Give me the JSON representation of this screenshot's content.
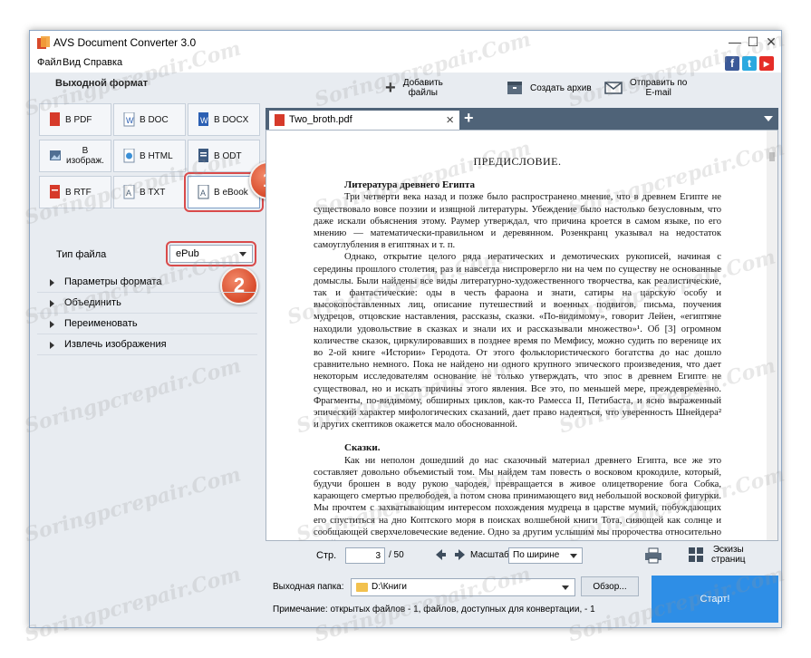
{
  "window": {
    "title": "AVS Document Converter 3.0",
    "controls": {
      "minimize": "—",
      "maximize": "☐",
      "close": "✕"
    }
  },
  "menu": [
    "Файл",
    "Вид",
    "Справка"
  ],
  "social": [
    "f",
    "t",
    "▶"
  ],
  "left_panel": {
    "header": "Выходной формат",
    "formats": [
      {
        "label": "В PDF",
        "icon": "pdf-icon"
      },
      {
        "label": "В DOC",
        "icon": "doc-icon"
      },
      {
        "label": "В DOCX",
        "icon": "docx-icon"
      },
      {
        "label": "В изображ.",
        "icon": "image-icon"
      },
      {
        "label": "В HTML",
        "icon": "html-icon"
      },
      {
        "label": "В ODT",
        "icon": "odt-icon"
      },
      {
        "label": "В RTF",
        "icon": "rtf-icon"
      },
      {
        "label": "В TXT",
        "icon": "txt-icon"
      },
      {
        "label": "В eBook",
        "icon": "ebook-icon",
        "selected": true
      }
    ],
    "file_type_label": "Тип файла",
    "file_type_value": "ePub",
    "sections": [
      "Параметры формата",
      "Объединить",
      "Переименовать",
      "Извлечь изображения"
    ],
    "badges": [
      "1",
      "2"
    ]
  },
  "toolbar": {
    "add_files": "Добавить\nфайлы",
    "create_archive": "Создать архив",
    "send_email": "Отправить по\nE-mail"
  },
  "tabs": [
    {
      "label": "Two_broth.pdf"
    }
  ],
  "document": {
    "heading": "ПРЕДИСЛОВИЕ.",
    "section1_title": "Литература древнего Египта",
    "para1": "Три четверти века назад и позже было распространено мнение, что в древнем Египте не существовало вовсе поэзии и изящной литературы. Убеждение было настолько безусловным, что даже искали объяснения этому. Раумер утверждал, что причина кроется в самом языке, по его мнению — математически-правильном и деревянном. Розенкранц указывал на недостаток самоуглубления в египтянах и т. п.",
    "para2": "Однако, открытие целого ряда иератических и демотических рукописей, начиная с середины прошлого столетия, раз и навсегда ниспровергло ни на чем по существу не основанные домыслы. Были найдены все виды литературно-художественного творчества, как реалистические, так и фантастические: оды в честь фараона и знати, сатиры на царскую особу и высокопоставленных лиц, описание путешествий и военных подвигов, письма, поучения мудрецов, отцовские наставления, рассказы, сказки. «По-видимому», говорит Лейен, «египтяне находили удовольствие в сказках и знали их и рассказывали множество»¹. Об [3] огромном количестве сказок, циркулировавших в позднее время по Мемфису, можно судить по веренице их во 2-ой книге «Истории» Геродота. От этого фольклористического богатства до нас дошло сравнительно немного. Пока не найдено ни одного крупного эпического произведения, что дает некоторым исследователям основание не только утверждать, что эпос в древнем Египте не существовал, но и искать причины этого явления. Все это, по меньшей мере, преждевременно. Фрагменты, по-видимому, обширных циклов, как-то Рамесса II, Петибаста, и ясно выраженный эпический характер мифологических сказаний, дает право надеяться, что уверенность Шнейдера² и других скептиков окажется мало обоснованной.",
    "section2_title": "Сказки.",
    "para3": "Как ни неполон дошедший до нас сказочный материал древнего Египта, все же это составляет довольно объемистый том. Мы найдем там повесть о восковом крокодиле, который, будучи брошен в воду рукою чародея, превращается в живое олицетворение бога Собка, карающего смертью прелюбодея, а потом снова принимающего вид небольшой восковой фигурки. Мы прочтем с захватывающим интересом похождения мудреца в царстве мумий, побуждающих его спуститься на дно Коптского моря в поисках волшебной книги Тота, сияющей как солнце и сообщающей сверхчеловеческие ведение. Одно за другим услышим мы пророчества относительно детей, таинственно родившихся и долженствующих"
  },
  "nav": {
    "page_label": "Стр.",
    "page_current": "3",
    "page_total": "/ 50",
    "zoom_label": "Масштаб",
    "zoom_value": "По ширине",
    "thumbnails": "Эскизы\nстраниц"
  },
  "bottom": {
    "output_label": "Выходная папка:",
    "output_path": "D:\\Книги",
    "browse": "Обзор...",
    "start": "Старт!",
    "note": "Примечание: открытых файлов - 1, файлов, доступных для конвертации, - 1"
  },
  "watermark": "Soringpcrepair.Com",
  "colors": {
    "accent": "#2e8ee6",
    "badge": "#d84a2a",
    "tabbar": "#4f6378"
  }
}
